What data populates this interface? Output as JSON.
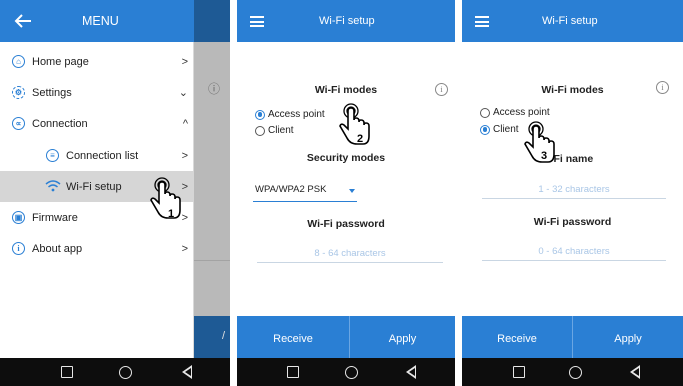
{
  "colors": {
    "brand": "#2a7fd4",
    "navbar": "#0d0d0d",
    "placeholder": "#a9c6e6"
  },
  "menu": {
    "title": "MENU",
    "items": [
      {
        "label": "Home page",
        "icon": "home-icon",
        "chevron": ">"
      },
      {
        "label": "Settings",
        "icon": "settings-icon",
        "chevron": "⌄"
      },
      {
        "label": "Connection",
        "icon": "share-icon",
        "chevron": "^"
      },
      {
        "label": "Connection list",
        "icon": "list-icon",
        "chevron": ">"
      },
      {
        "label": "Wi-Fi setup",
        "icon": "wifi-icon",
        "chevron": ">"
      },
      {
        "label": "Firmware",
        "icon": "chip-icon",
        "chevron": ">"
      },
      {
        "label": "About app",
        "icon": "info-icon",
        "chevron": ">"
      }
    ],
    "background_info": "ⓘ",
    "background_slash": "/"
  },
  "panel2": {
    "title": "Wi-Fi setup",
    "modes_heading": "Wi-Fi modes",
    "info": "i",
    "options": [
      "Access point",
      "Client"
    ],
    "selected": "Access point",
    "security_heading": "Security modes",
    "security_value": "WPA/WPA2 PSK",
    "password_heading": "Wi-Fi password",
    "password_placeholder": "8 - 64 characters",
    "receive": "Receive",
    "apply": "Apply"
  },
  "panel3": {
    "title": "Wi-Fi setup",
    "modes_heading": "Wi-Fi modes",
    "info": "i",
    "options": [
      "Access point",
      "Client"
    ],
    "selected": "Client",
    "name_heading": "-Fi name",
    "name_placeholder": "1 - 32 characters",
    "password_heading": "Wi-Fi password",
    "password_placeholder": "0 - 64 characters",
    "receive": "Receive",
    "apply": "Apply"
  },
  "steps": [
    "1",
    "2",
    "3"
  ],
  "navbar": {
    "keys": [
      "recents-key",
      "home-key",
      "back-key"
    ]
  }
}
